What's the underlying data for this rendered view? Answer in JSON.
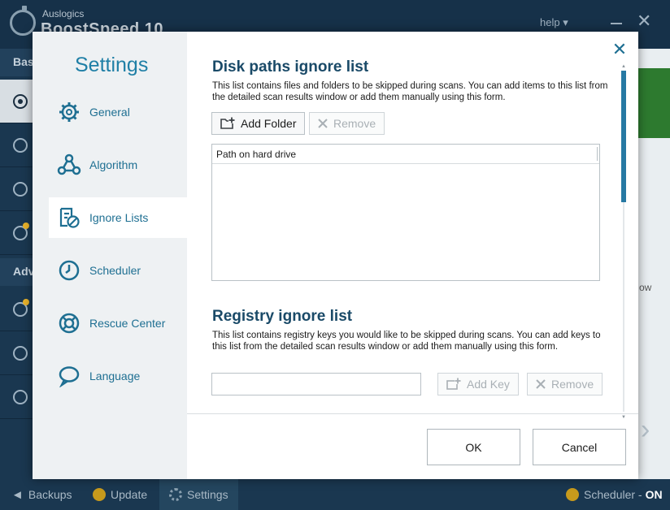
{
  "app": {
    "brand_small": "Auslogics",
    "brand_big": "BoostSpeed 10",
    "help_label": "help ▾",
    "rail_section_basic": "Bas",
    "rail_section_adv": "Adv",
    "strip_text": "ow",
    "statusbar": {
      "backups": "Backups",
      "update": "Update",
      "settings": "Settings",
      "scheduler": "Scheduler -",
      "scheduler_state": "ON"
    }
  },
  "dialog": {
    "nav_title": "Settings",
    "nav_items": [
      {
        "label": "General",
        "icon": "gear-icon"
      },
      {
        "label": "Algorithm",
        "icon": "algorithm-icon"
      },
      {
        "label": "Ignore Lists",
        "icon": "ignore-list-icon",
        "selected": true
      },
      {
        "label": "Scheduler",
        "icon": "clock-icon"
      },
      {
        "label": "Rescue Center",
        "icon": "lifebuoy-icon"
      },
      {
        "label": "Language",
        "icon": "speech-bubble-icon"
      }
    ],
    "close_glyph": "✕",
    "disk": {
      "heading": "Disk paths ignore list",
      "description": "This list contains files and folders to be skipped during scans. You can add items to this list from the detailed scan results window or add them manually using this form.",
      "add_label": "Add Folder",
      "remove_label": "Remove",
      "column_header": "Path on hard drive"
    },
    "registry": {
      "heading": "Registry ignore list",
      "description": "This list contains registry keys you would like to be skipped during scans. You can add keys to this list from the detailed scan results window or add them manually using this form.",
      "input_value": "",
      "add_label": "Add Key",
      "remove_label": "Remove"
    },
    "ok_label": "OK",
    "cancel_label": "Cancel"
  },
  "colors": {
    "accent": "#1e6f92",
    "heading": "#1a4a68",
    "scroll_thumb": "#2679a3",
    "app_bg": "#15324a"
  }
}
